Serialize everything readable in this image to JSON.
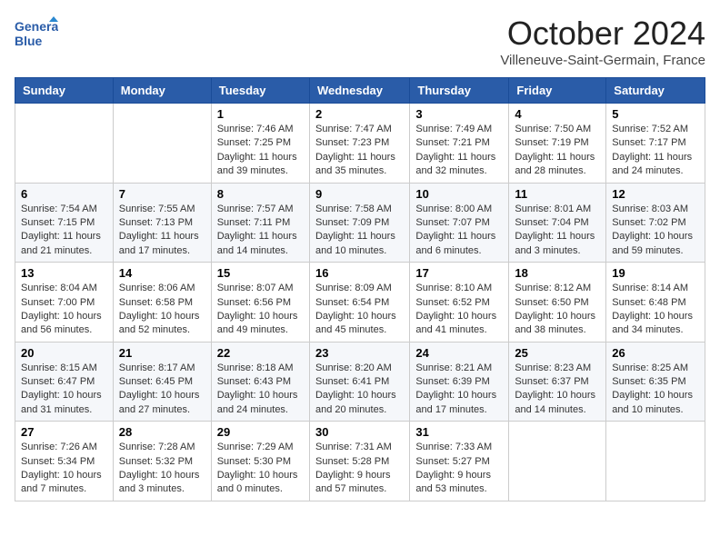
{
  "header": {
    "logo_line1": "General",
    "logo_line2": "Blue",
    "month": "October 2024",
    "location": "Villeneuve-Saint-Germain, France"
  },
  "weekdays": [
    "Sunday",
    "Monday",
    "Tuesday",
    "Wednesday",
    "Thursday",
    "Friday",
    "Saturday"
  ],
  "weeks": [
    [
      {
        "day": "",
        "sunrise": "",
        "sunset": "",
        "daylight": ""
      },
      {
        "day": "",
        "sunrise": "",
        "sunset": "",
        "daylight": ""
      },
      {
        "day": "1",
        "sunrise": "Sunrise: 7:46 AM",
        "sunset": "Sunset: 7:25 PM",
        "daylight": "Daylight: 11 hours and 39 minutes."
      },
      {
        "day": "2",
        "sunrise": "Sunrise: 7:47 AM",
        "sunset": "Sunset: 7:23 PM",
        "daylight": "Daylight: 11 hours and 35 minutes."
      },
      {
        "day": "3",
        "sunrise": "Sunrise: 7:49 AM",
        "sunset": "Sunset: 7:21 PM",
        "daylight": "Daylight: 11 hours and 32 minutes."
      },
      {
        "day": "4",
        "sunrise": "Sunrise: 7:50 AM",
        "sunset": "Sunset: 7:19 PM",
        "daylight": "Daylight: 11 hours and 28 minutes."
      },
      {
        "day": "5",
        "sunrise": "Sunrise: 7:52 AM",
        "sunset": "Sunset: 7:17 PM",
        "daylight": "Daylight: 11 hours and 24 minutes."
      }
    ],
    [
      {
        "day": "6",
        "sunrise": "Sunrise: 7:54 AM",
        "sunset": "Sunset: 7:15 PM",
        "daylight": "Daylight: 11 hours and 21 minutes."
      },
      {
        "day": "7",
        "sunrise": "Sunrise: 7:55 AM",
        "sunset": "Sunset: 7:13 PM",
        "daylight": "Daylight: 11 hours and 17 minutes."
      },
      {
        "day": "8",
        "sunrise": "Sunrise: 7:57 AM",
        "sunset": "Sunset: 7:11 PM",
        "daylight": "Daylight: 11 hours and 14 minutes."
      },
      {
        "day": "9",
        "sunrise": "Sunrise: 7:58 AM",
        "sunset": "Sunset: 7:09 PM",
        "daylight": "Daylight: 11 hours and 10 minutes."
      },
      {
        "day": "10",
        "sunrise": "Sunrise: 8:00 AM",
        "sunset": "Sunset: 7:07 PM",
        "daylight": "Daylight: 11 hours and 6 minutes."
      },
      {
        "day": "11",
        "sunrise": "Sunrise: 8:01 AM",
        "sunset": "Sunset: 7:04 PM",
        "daylight": "Daylight: 11 hours and 3 minutes."
      },
      {
        "day": "12",
        "sunrise": "Sunrise: 8:03 AM",
        "sunset": "Sunset: 7:02 PM",
        "daylight": "Daylight: 10 hours and 59 minutes."
      }
    ],
    [
      {
        "day": "13",
        "sunrise": "Sunrise: 8:04 AM",
        "sunset": "Sunset: 7:00 PM",
        "daylight": "Daylight: 10 hours and 56 minutes."
      },
      {
        "day": "14",
        "sunrise": "Sunrise: 8:06 AM",
        "sunset": "Sunset: 6:58 PM",
        "daylight": "Daylight: 10 hours and 52 minutes."
      },
      {
        "day": "15",
        "sunrise": "Sunrise: 8:07 AM",
        "sunset": "Sunset: 6:56 PM",
        "daylight": "Daylight: 10 hours and 49 minutes."
      },
      {
        "day": "16",
        "sunrise": "Sunrise: 8:09 AM",
        "sunset": "Sunset: 6:54 PM",
        "daylight": "Daylight: 10 hours and 45 minutes."
      },
      {
        "day": "17",
        "sunrise": "Sunrise: 8:10 AM",
        "sunset": "Sunset: 6:52 PM",
        "daylight": "Daylight: 10 hours and 41 minutes."
      },
      {
        "day": "18",
        "sunrise": "Sunrise: 8:12 AM",
        "sunset": "Sunset: 6:50 PM",
        "daylight": "Daylight: 10 hours and 38 minutes."
      },
      {
        "day": "19",
        "sunrise": "Sunrise: 8:14 AM",
        "sunset": "Sunset: 6:48 PM",
        "daylight": "Daylight: 10 hours and 34 minutes."
      }
    ],
    [
      {
        "day": "20",
        "sunrise": "Sunrise: 8:15 AM",
        "sunset": "Sunset: 6:47 PM",
        "daylight": "Daylight: 10 hours and 31 minutes."
      },
      {
        "day": "21",
        "sunrise": "Sunrise: 8:17 AM",
        "sunset": "Sunset: 6:45 PM",
        "daylight": "Daylight: 10 hours and 27 minutes."
      },
      {
        "day": "22",
        "sunrise": "Sunrise: 8:18 AM",
        "sunset": "Sunset: 6:43 PM",
        "daylight": "Daylight: 10 hours and 24 minutes."
      },
      {
        "day": "23",
        "sunrise": "Sunrise: 8:20 AM",
        "sunset": "Sunset: 6:41 PM",
        "daylight": "Daylight: 10 hours and 20 minutes."
      },
      {
        "day": "24",
        "sunrise": "Sunrise: 8:21 AM",
        "sunset": "Sunset: 6:39 PM",
        "daylight": "Daylight: 10 hours and 17 minutes."
      },
      {
        "day": "25",
        "sunrise": "Sunrise: 8:23 AM",
        "sunset": "Sunset: 6:37 PM",
        "daylight": "Daylight: 10 hours and 14 minutes."
      },
      {
        "day": "26",
        "sunrise": "Sunrise: 8:25 AM",
        "sunset": "Sunset: 6:35 PM",
        "daylight": "Daylight: 10 hours and 10 minutes."
      }
    ],
    [
      {
        "day": "27",
        "sunrise": "Sunrise: 7:26 AM",
        "sunset": "Sunset: 5:34 PM",
        "daylight": "Daylight: 10 hours and 7 minutes."
      },
      {
        "day": "28",
        "sunrise": "Sunrise: 7:28 AM",
        "sunset": "Sunset: 5:32 PM",
        "daylight": "Daylight: 10 hours and 3 minutes."
      },
      {
        "day": "29",
        "sunrise": "Sunrise: 7:29 AM",
        "sunset": "Sunset: 5:30 PM",
        "daylight": "Daylight: 10 hours and 0 minutes."
      },
      {
        "day": "30",
        "sunrise": "Sunrise: 7:31 AM",
        "sunset": "Sunset: 5:28 PM",
        "daylight": "Daylight: 9 hours and 57 minutes."
      },
      {
        "day": "31",
        "sunrise": "Sunrise: 7:33 AM",
        "sunset": "Sunset: 5:27 PM",
        "daylight": "Daylight: 9 hours and 53 minutes."
      },
      {
        "day": "",
        "sunrise": "",
        "sunset": "",
        "daylight": ""
      },
      {
        "day": "",
        "sunrise": "",
        "sunset": "",
        "daylight": ""
      }
    ]
  ]
}
